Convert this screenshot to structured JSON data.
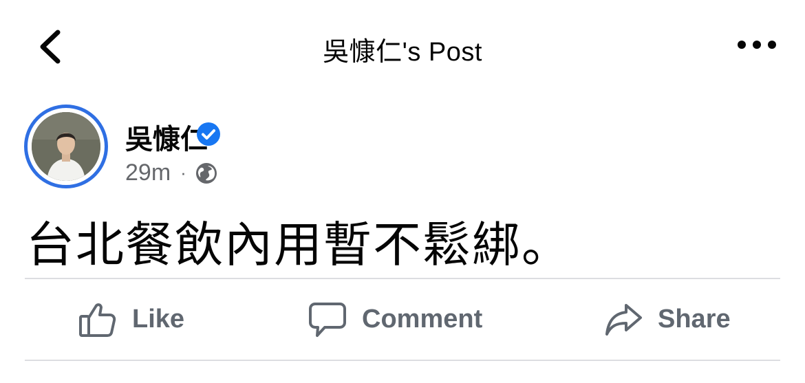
{
  "header": {
    "title": "吳慷仁's Post",
    "back_icon": "chevron-left-icon",
    "more_icon": "ellipsis-icon"
  },
  "post": {
    "author": "吳慷仁",
    "verified_icon": "verified-badge-icon",
    "time": "29m",
    "separator": "·",
    "privacy_icon": "globe-icon",
    "text": "台北餐飲內用暫不鬆綁。"
  },
  "actions": {
    "like_label": "Like",
    "comment_label": "Comment",
    "share_label": "Share"
  },
  "colors": {
    "accent": "#2f6fe3",
    "verified": "#1877f2",
    "secondary_text": "#65676b",
    "action_text": "#606770",
    "divider": "#dcdde1"
  }
}
